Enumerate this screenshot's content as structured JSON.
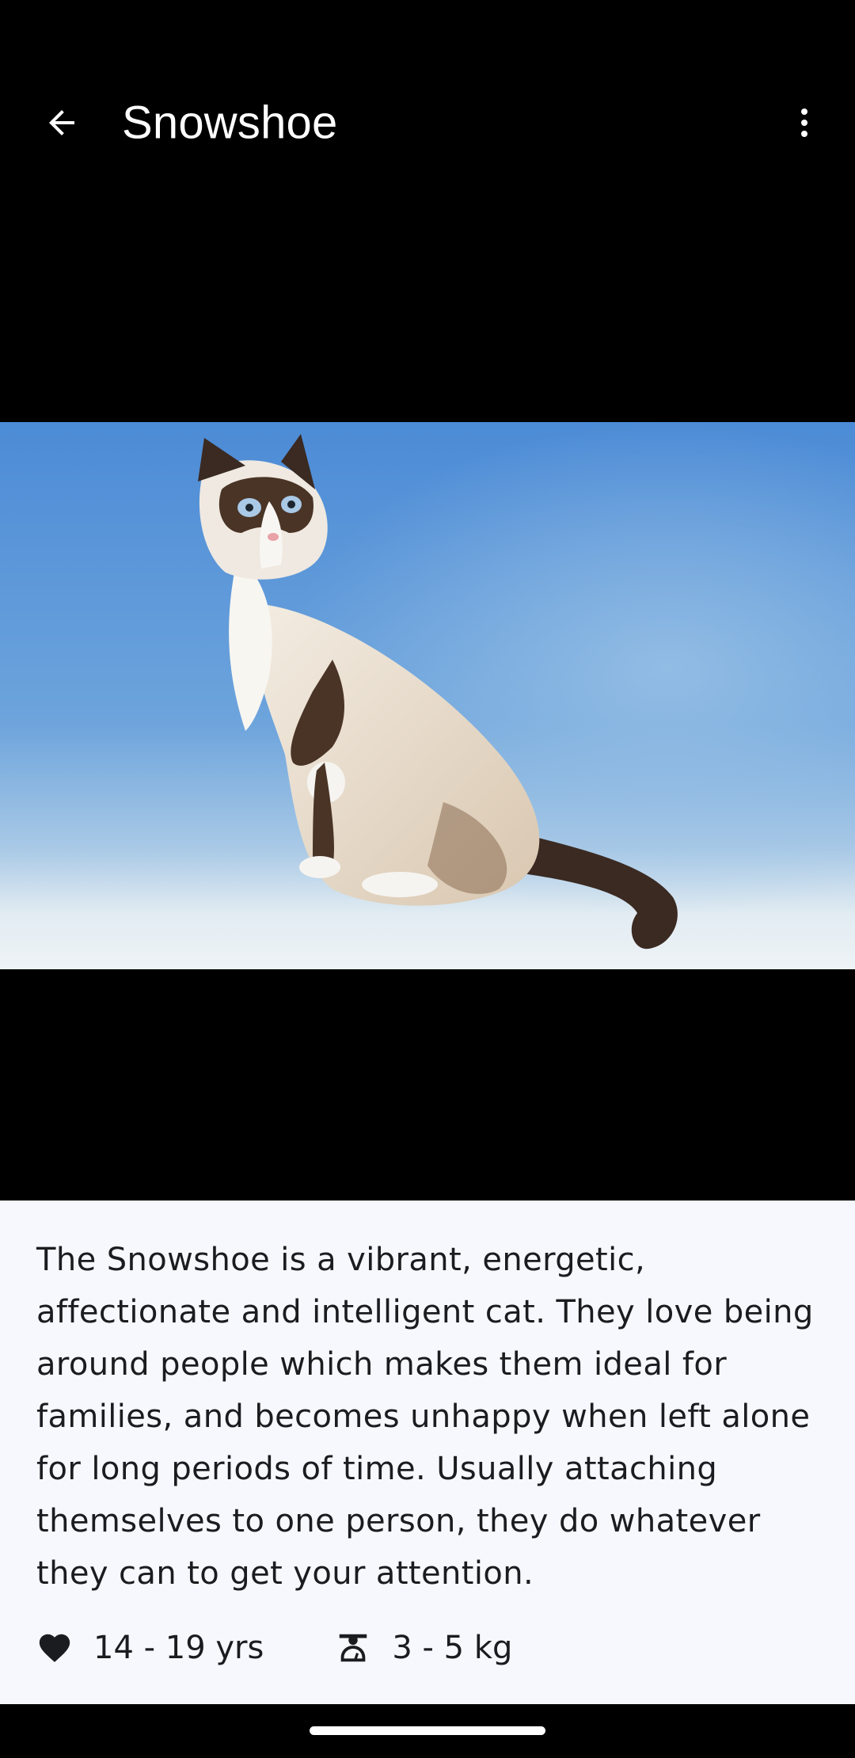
{
  "app_bar": {
    "title": "Snowshoe",
    "back_icon": "arrow-back-icon",
    "more_icon": "more-vert-icon"
  },
  "photo": {
    "alt": "Snowshoe cat sitting on blue background"
  },
  "details": {
    "description": "The Snowshoe is a vibrant, energetic, affectionate and intelligent cat. They love being around people which makes them ideal for families, and becomes unhappy when left alone for long periods of time. Usually attaching themselves to one person, they do whatever they can to get your attention.",
    "lifespan": {
      "icon": "heart-icon",
      "value": "14 - 19 yrs"
    },
    "weight": {
      "icon": "scale-icon",
      "value": "3 - 5 kg"
    }
  },
  "colors": {
    "background": "#000000",
    "content_background": "#f6f8fd",
    "text": "#1b1c20",
    "sky_top": "#4f8fd8",
    "floor": "#e6eef4"
  }
}
